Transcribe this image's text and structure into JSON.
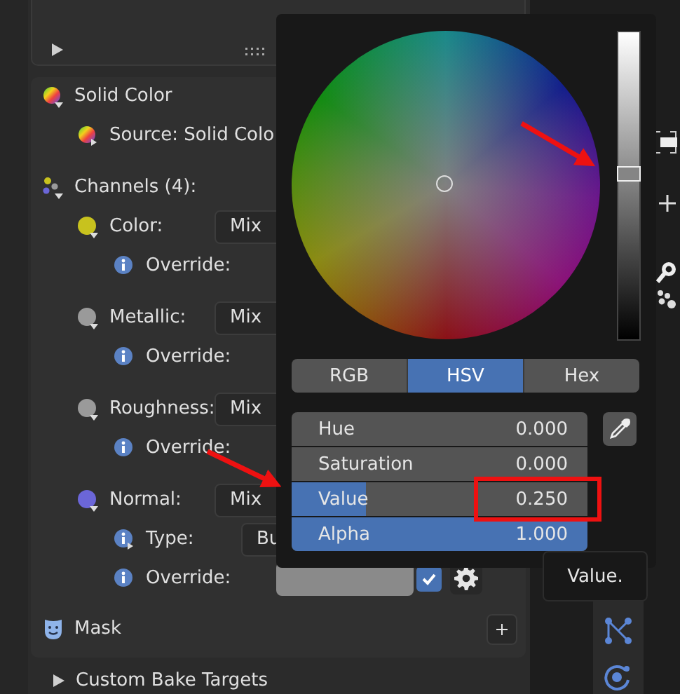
{
  "properties": {
    "rows": [
      {
        "kind": "header",
        "label": "Solid Color"
      },
      {
        "kind": "source",
        "label": "Source: Solid Colo"
      },
      {
        "kind": "channels",
        "label": "Channels (4):"
      },
      {
        "kind": "channel",
        "label": "Color:",
        "dropdown": "Mix",
        "color": "#c8c21e"
      },
      {
        "kind": "override",
        "label": "Override:"
      },
      {
        "kind": "channel",
        "label": "Metallic:",
        "dropdown": "Mix",
        "color": "#9a9a9a"
      },
      {
        "kind": "override",
        "label": "Override:"
      },
      {
        "kind": "channel",
        "label": "Roughness:",
        "dropdown": "Mix",
        "color": "#9a9a9a"
      },
      {
        "kind": "override",
        "label": "Override:"
      },
      {
        "kind": "channel",
        "label": "Normal:",
        "dropdown": "Mix",
        "color": "#6b66d8"
      },
      {
        "kind": "type",
        "label": "Type:",
        "dropdown": "Bu"
      },
      {
        "kind": "override_color",
        "label": "Override:",
        "checked": true
      },
      {
        "kind": "mask",
        "label": "Mask"
      }
    ]
  },
  "collapsed_panel": {
    "label": "Custom Bake Targets"
  },
  "color_picker": {
    "brightness": {
      "level": 0.54
    },
    "modes": [
      {
        "label": "RGB",
        "selected": false
      },
      {
        "label": "HSV",
        "selected": true
      },
      {
        "label": "Hex",
        "selected": false
      }
    ],
    "fields": [
      {
        "label": "Hue",
        "value": "0.000"
      },
      {
        "label": "Saturation",
        "value": "0.000"
      },
      {
        "label": "Value",
        "value": "0.250",
        "level": 0.25
      },
      {
        "label": "Alpha",
        "value": "1.000",
        "level": 1
      }
    ]
  },
  "tooltip": {
    "text": "Value."
  }
}
